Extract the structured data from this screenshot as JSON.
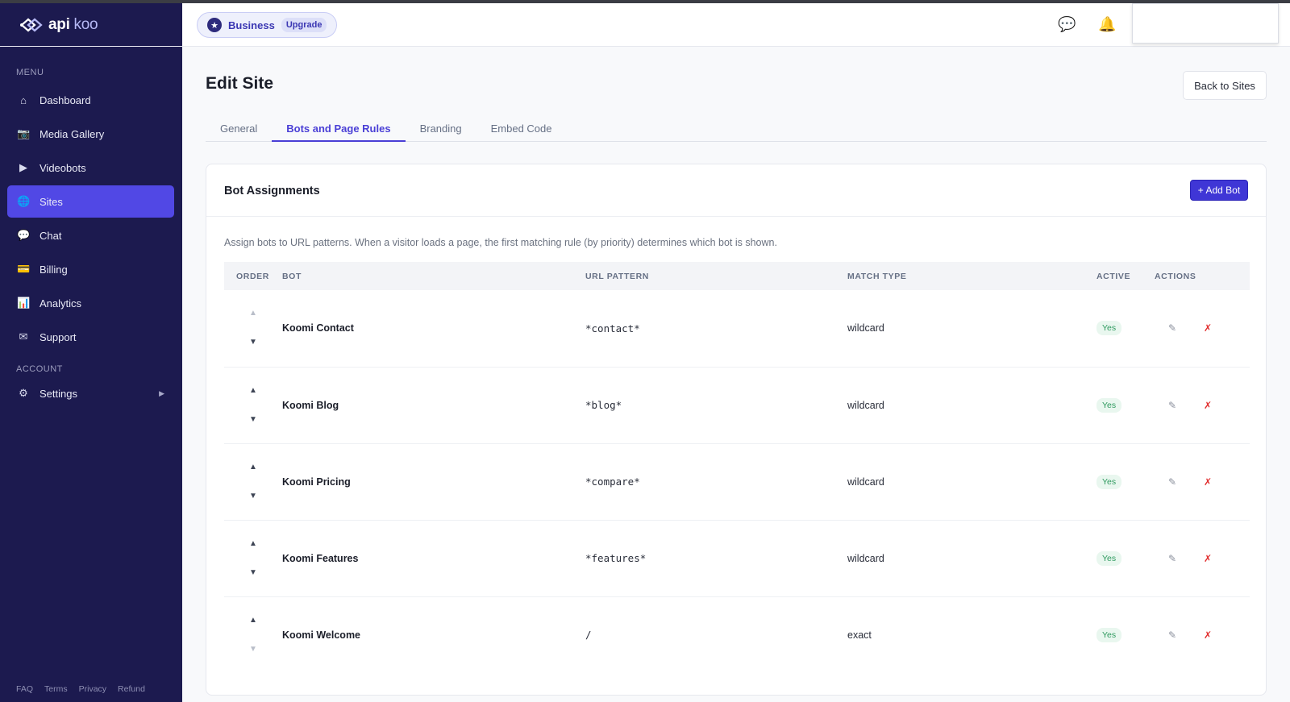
{
  "app": {
    "logo_text_1": "api",
    "logo_text_2": " koo"
  },
  "sidebar": {
    "menu_label": "MENU",
    "items": [
      {
        "label": "Dashboard",
        "icon": "home-icon",
        "glyph": "⌂",
        "active": false
      },
      {
        "label": "Media Gallery",
        "icon": "camera-icon",
        "glyph": "📷",
        "active": false
      },
      {
        "label": "Videobots",
        "icon": "play-icon",
        "glyph": "▶",
        "active": false
      },
      {
        "label": "Sites",
        "icon": "globe-icon",
        "glyph": "🌐",
        "active": true
      },
      {
        "label": "Chat",
        "icon": "chat-icon",
        "glyph": "💬",
        "active": false
      },
      {
        "label": "Billing",
        "icon": "credit-card-icon",
        "glyph": "💳",
        "active": false
      },
      {
        "label": "Analytics",
        "icon": "bar-chart-icon",
        "glyph": "📊",
        "active": false
      },
      {
        "label": "Support",
        "icon": "mail-icon",
        "glyph": "✉",
        "active": false
      }
    ],
    "account_label": "ACCOUNT",
    "settings": {
      "label": "Settings",
      "icon": "gear-icon",
      "glyph": "⚙"
    },
    "footer": [
      "FAQ",
      "Terms",
      "Privacy",
      "Refund"
    ]
  },
  "header": {
    "plan_name": "Business",
    "upgrade_label": "Upgrade",
    "chat_glyph": "💬",
    "bell_glyph": "🔔"
  },
  "page": {
    "title": "Edit Site",
    "back_label": "Back to Sites",
    "tabs": [
      {
        "label": "General",
        "active": false
      },
      {
        "label": "Bots and Page Rules",
        "active": true
      },
      {
        "label": "Branding",
        "active": false
      },
      {
        "label": "Embed Code",
        "active": false
      }
    ]
  },
  "card": {
    "title": "Bot Assignments",
    "add_label": "+ Add Bot",
    "description": "Assign bots to URL patterns. When a visitor loads a page, the first matching rule (by priority) determines which bot is shown.",
    "columns": [
      "ORDER",
      "BOT",
      "URL PATTERN",
      "MATCH TYPE",
      "ACTIVE",
      "ACTIONS"
    ],
    "rows": [
      {
        "bot": "Koomi Contact",
        "url": "*contact*",
        "match": "wildcard",
        "active": "Yes"
      },
      {
        "bot": "Koomi Blog",
        "url": "*blog*",
        "match": "wildcard",
        "active": "Yes"
      },
      {
        "bot": "Koomi Pricing",
        "url": "*compare*",
        "match": "wildcard",
        "active": "Yes"
      },
      {
        "bot": "Koomi Features",
        "url": "*features*",
        "match": "wildcard",
        "active": "Yes"
      },
      {
        "bot": "Koomi Welcome",
        "url": "/",
        "match": "exact",
        "active": "Yes"
      }
    ],
    "up_glyph": "▲",
    "down_glyph": "▼",
    "edit_glyph": "✎",
    "delete_glyph": "✗"
  },
  "colors": {
    "sidebar_bg": "#1c1a4f",
    "accent": "#4a3fd6",
    "active_nav": "#5148e5",
    "delete_red": "#e12d2d",
    "active_green": "#2f9a5f"
  }
}
